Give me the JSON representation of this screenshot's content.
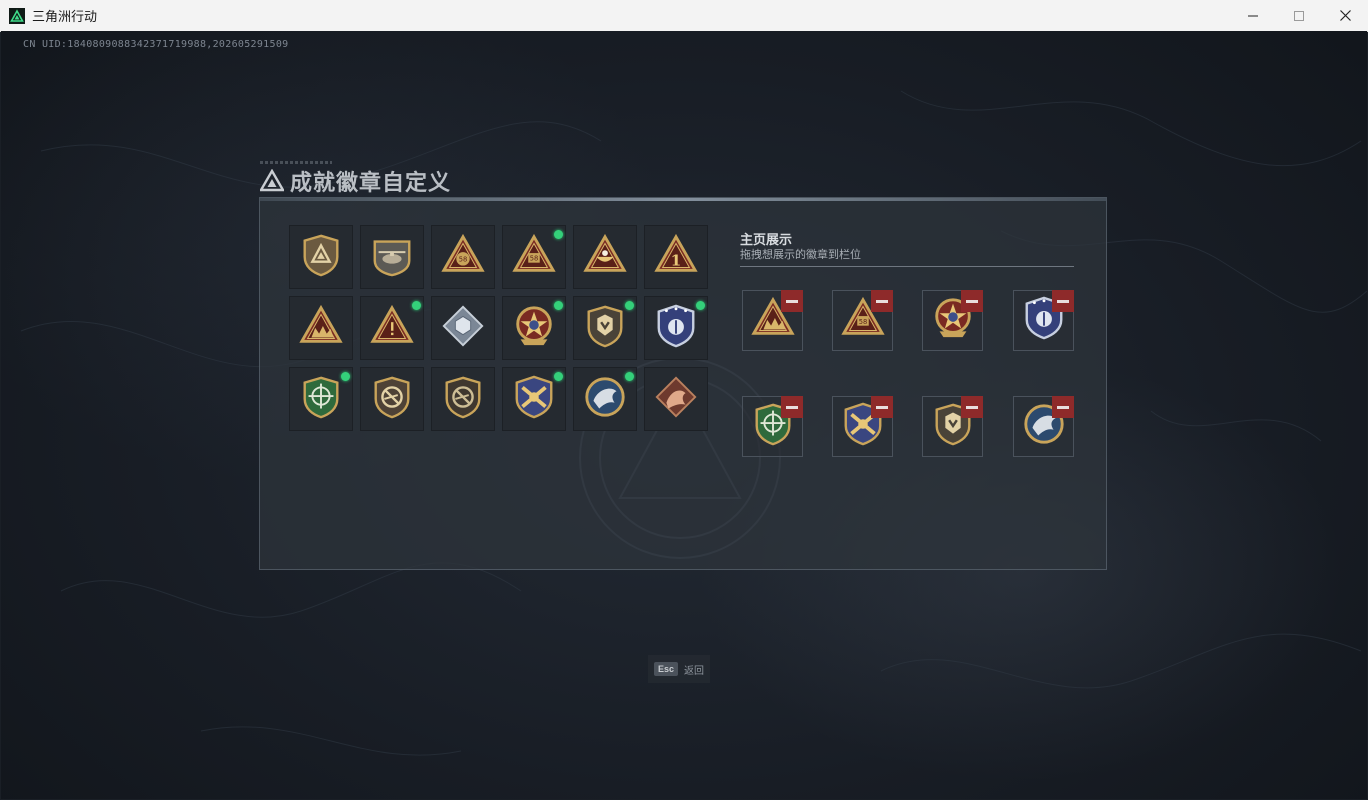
{
  "window": {
    "title": "三角洲行动",
    "controls": [
      "minimize-icon",
      "maximize-icon",
      "close-icon"
    ]
  },
  "uid_text": "CN UID:1840809088342371719988,202605291509",
  "dialog": {
    "title": "成就徽章自定义",
    "title_icon": "delta-triangle-icon"
  },
  "badges": [
    {
      "icon": "shield-triangle-badge",
      "new": false
    },
    {
      "icon": "helicopter-triangle-badge",
      "new": false
    },
    {
      "icon": "bag-triangle-badge",
      "new": false
    },
    {
      "icon": "number-58-triangle-badge",
      "new": true
    },
    {
      "icon": "bowl-triangle-badge",
      "new": false
    },
    {
      "icon": "number-1-triangle-badge",
      "new": false
    },
    {
      "icon": "squad-triangle-badge",
      "new": false
    },
    {
      "icon": "warning-triangle-badge",
      "new": true
    },
    {
      "icon": "cube-diamond-badge",
      "new": false
    },
    {
      "icon": "star-medal-badge",
      "new": true
    },
    {
      "icon": "chevron-shield-badge",
      "new": true
    },
    {
      "icon": "blue-police-badge",
      "new": true
    },
    {
      "icon": "green-crosshair-shield-badge",
      "new": true
    },
    {
      "icon": "no-rifle-shield-badge",
      "new": false
    },
    {
      "icon": "no-rifle-shield-badge-dark",
      "new": false
    },
    {
      "icon": "crossed-swords-shield-badge",
      "new": true
    },
    {
      "icon": "eagle-circle-badge",
      "new": true
    },
    {
      "icon": "dragon-diamond-badge",
      "new": false
    }
  ],
  "showcase": {
    "title": "主页展示",
    "hint": "拖拽想展示的徽章到栏位",
    "slots": [
      {
        "icon": "squad-triangle-badge"
      },
      {
        "icon": "number-58-triangle-badge"
      },
      {
        "icon": "star-medal-badge"
      },
      {
        "icon": "blue-police-badge"
      },
      {
        "icon": "green-crosshair-shield-badge"
      },
      {
        "icon": "crossed-swords-shield-badge"
      },
      {
        "icon": "chevron-shield-badge"
      },
      {
        "icon": "eagle-circle-badge"
      }
    ]
  },
  "footer": {
    "key": "Esc",
    "label": "返回"
  },
  "colors": {
    "accent_green": "#34d07a",
    "remove_red": "#8e2a2a",
    "gold": "#c9a45a",
    "triangle_red": "#7a2a22"
  }
}
